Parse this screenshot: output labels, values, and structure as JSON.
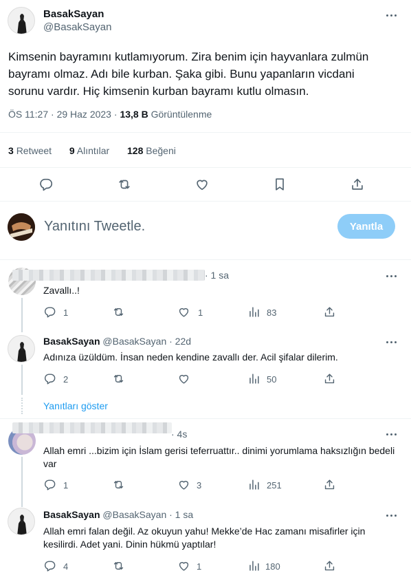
{
  "tweet": {
    "display_name": "BasakSayan",
    "handle": "@BasakSayan",
    "text": "Kimsenin bayramını kutlamıyorum. Zira benim için hayvanlara zulmün bayramı olmaz. Adı bile kurban. Şaka gibi. Bunu yapanların vicdani sorunu vardır. Hiç kimsenin kurban bayramı kutlu olmasın.",
    "time": "ÖS 11:27",
    "date": "29 Haz 2023",
    "separator": "·",
    "views_count": "13,8 B",
    "views_label": "Görüntülenme",
    "retweets_count": "3",
    "retweets_label": "Retweet",
    "quotes_count": "9",
    "quotes_label": "Alıntılar",
    "likes_count": "128",
    "likes_label": "Beğeni"
  },
  "compose": {
    "placeholder": "Yanıtını Tweetle.",
    "reply_button": "Yanıtla",
    "button_color": "#8ecdf8"
  },
  "replies": [
    {
      "display_name": "",
      "handle": "",
      "time": "· 1 sa",
      "text": "Zavallı..!",
      "reply_count": "1",
      "retweet_count": "",
      "like_count": "1",
      "view_count": "83"
    },
    {
      "display_name": "BasakSayan",
      "handle": "@BasakSayan",
      "time": "· 22d",
      "text": "Adınıza üzüldüm. İnsan neden kendine zavallı der. Acil şifalar dilerim.",
      "reply_count": "2",
      "retweet_count": "",
      "like_count": "",
      "view_count": "50"
    },
    {
      "display_name": "",
      "handle": "",
      "time": "· 4s",
      "text": "Allah emri ...bizim için İslam gerisi teferruattır.. dinimi yorumlama haksızlığın bedeli var",
      "reply_count": "1",
      "retweet_count": "",
      "like_count": "3",
      "view_count": "251"
    },
    {
      "display_name": "BasakSayan",
      "handle": "@BasakSayan",
      "time": "· 1 sa",
      "text": "Allah emri falan değil. Az okuyun yahu! Mekke’de Hac zamanı misafirler için kesilirdi. Adet yani. Dinin hükmü yaptılar!",
      "reply_count": "4",
      "retweet_count": "",
      "like_count": "1",
      "view_count": "180"
    }
  ],
  "show_replies_link": "Yanıtları göster",
  "icons": [
    "more-icon",
    "reply-icon",
    "retweet-icon",
    "like-icon",
    "bookmark-icon",
    "share-icon",
    "views-icon"
  ],
  "colors": {
    "accent": "#1d9bf0",
    "muted": "#536471",
    "text": "#0f1419",
    "divider": "#eff3f4"
  }
}
